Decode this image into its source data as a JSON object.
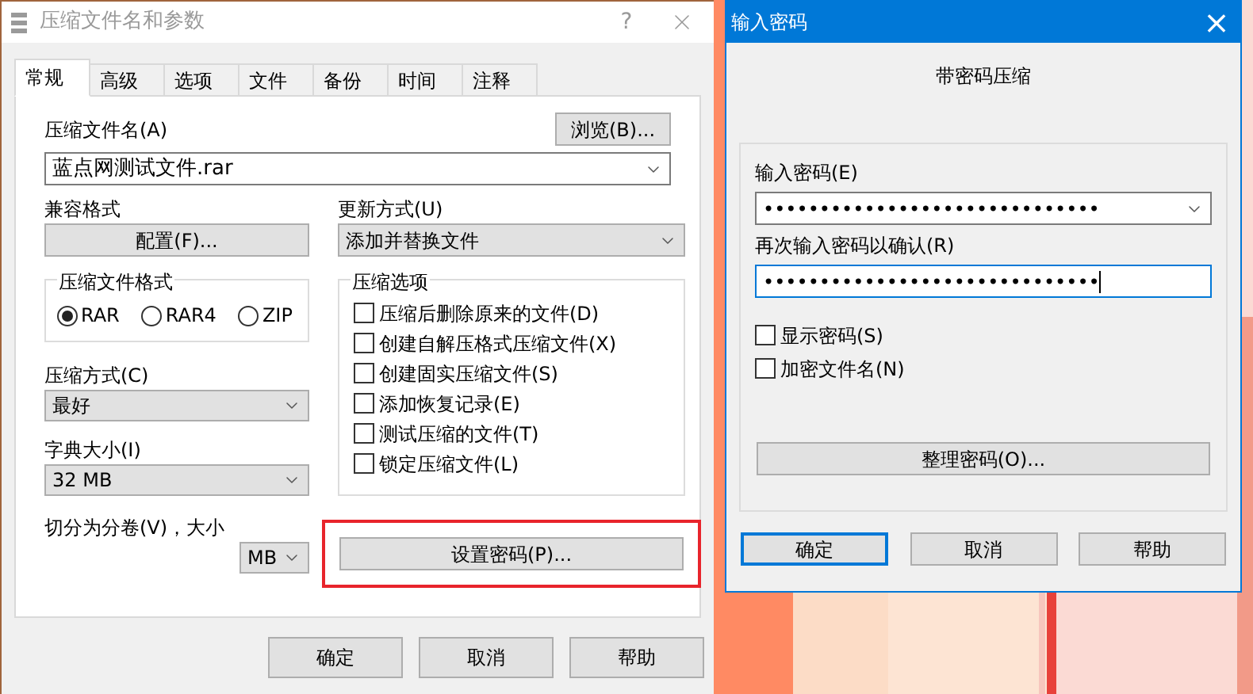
{
  "main_dialog": {
    "title": "压缩文件名和参数",
    "help": "?",
    "tabs": [
      {
        "label": "常规",
        "selected": true
      },
      {
        "label": "高级",
        "selected": false
      },
      {
        "label": "选项",
        "selected": false
      },
      {
        "label": "文件",
        "selected": false
      },
      {
        "label": "备份",
        "selected": false
      },
      {
        "label": "时间",
        "selected": false
      },
      {
        "label": "注释",
        "selected": false
      }
    ],
    "archive_name": {
      "label": "压缩文件名(A)",
      "value": "蓝点网测试文件.rar",
      "browse": "浏览(B)..."
    },
    "compat": {
      "label": "兼容格式",
      "button": "配置(F)..."
    },
    "update": {
      "label": "更新方式(U)",
      "value": "添加并替换文件"
    },
    "format": {
      "title": "压缩文件格式",
      "options": [
        {
          "label": "RAR",
          "selected": true
        },
        {
          "label": "RAR4",
          "selected": false
        },
        {
          "label": "ZIP",
          "selected": false
        }
      ]
    },
    "method": {
      "label": "压缩方式(C)",
      "value": "最好"
    },
    "dictionary": {
      "label": "字典大小(I)",
      "value": "32 MB"
    },
    "split": {
      "label": "切分为分卷(V)，大小",
      "unit": "MB"
    },
    "options": {
      "title": "压缩选项",
      "items": [
        {
          "label": "压缩后删除原来的文件(D)",
          "checked": false
        },
        {
          "label": "创建自解压格式压缩文件(X)",
          "checked": false
        },
        {
          "label": "创建固实压缩文件(S)",
          "checked": false
        },
        {
          "label": "添加恢复记录(E)",
          "checked": false
        },
        {
          "label": "测试压缩的文件(T)",
          "checked": false
        },
        {
          "label": "锁定压缩文件(L)",
          "checked": false
        }
      ]
    },
    "set_password": {
      "label": "设置密码(P)...",
      "highlighted": true
    },
    "buttons": [
      {
        "label": "确定",
        "default": false
      },
      {
        "label": "取消",
        "default": false
      },
      {
        "label": "帮助",
        "default": false
      }
    ]
  },
  "password_dialog": {
    "title": "输入密码",
    "close": "×",
    "heading": "带密码压缩",
    "password": {
      "label": "输入密码(E)",
      "value": "••••••••••••••••••••••••••••••"
    },
    "confirm": {
      "label": "再次输入密码以确认(R)",
      "value": "••••••••••••••••••••••••••••••",
      "focused": true
    },
    "checkboxes": [
      {
        "label": "显示密码(S)",
        "checked": false
      },
      {
        "label": "加密文件名(N)",
        "checked": false
      }
    ],
    "organize": "整理密码(O)...",
    "buttons": [
      {
        "label": "确定",
        "default": true
      },
      {
        "label": "取消",
        "default": false
      },
      {
        "label": "帮助",
        "default": false
      }
    ]
  }
}
